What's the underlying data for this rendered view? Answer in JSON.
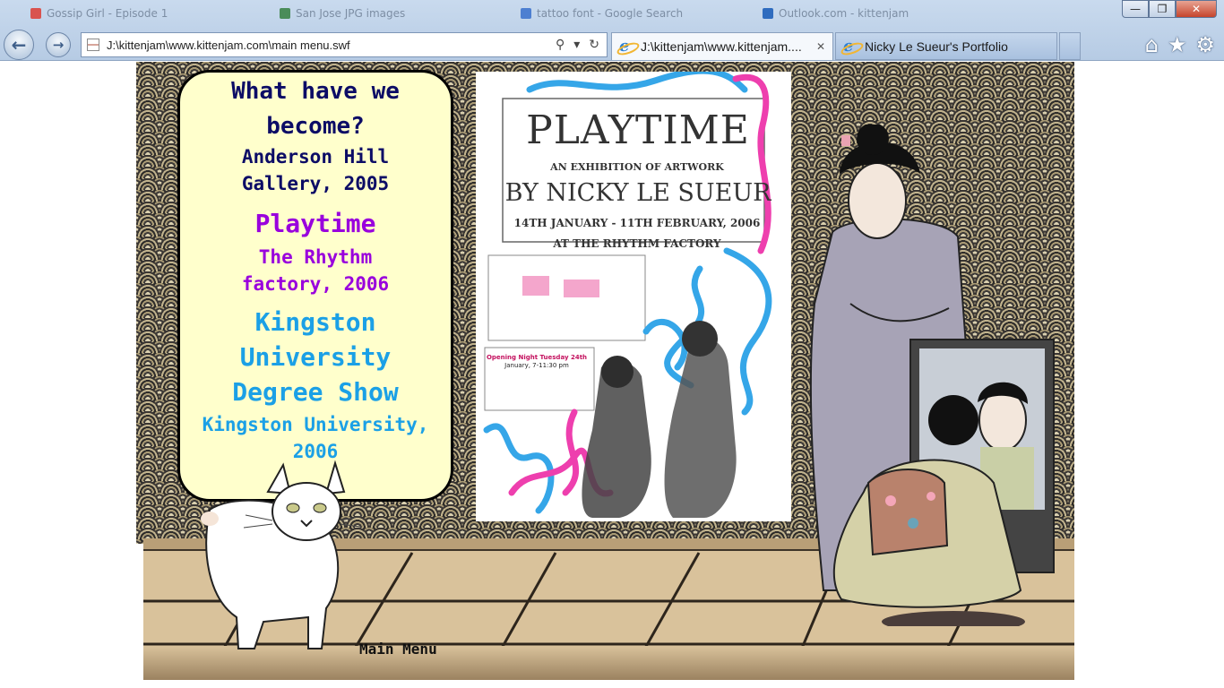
{
  "browser": {
    "background_tabs": [
      "Gossip Girl - Episode 1",
      "San Jose JPG images",
      "tattoo font - Google Search",
      "Outlook.com - kittenjam"
    ],
    "address_url": "J:\\kittenjam\\www.kittenjam.com\\main menu.swf",
    "tabs": [
      {
        "label": "J:\\kittenjam\\www.kittenjam....",
        "active": true
      },
      {
        "label": "Nicky Le Sueur's Portfolio",
        "active": false
      }
    ],
    "window_buttons": {
      "minimize": "—",
      "restore": "❐",
      "close": "✕"
    },
    "icons": {
      "back": "back-arrow-icon",
      "forward": "forward-arrow-icon",
      "home": "home-icon",
      "favorites": "star-icon",
      "tools": "gear-icon"
    }
  },
  "panel": {
    "heading": [
      "What have we",
      "become?"
    ],
    "heading_venue": [
      "Anderson Hill",
      "Gallery, 2005"
    ],
    "playtime_title": "Playtime",
    "playtime_venue": [
      "The Rhythm",
      "factory, 2006"
    ],
    "kingston_title": [
      "Kingston",
      "University",
      "Degree Show"
    ],
    "kingston_venue": [
      "Kingston University,",
      "2006"
    ]
  },
  "poster": {
    "title": "PLAYTIME",
    "subtitle": "AN EXHIBITION OF ARTWORK",
    "by_line": "BY NICKY LE SUEUR",
    "dates": "14TH JANUARY - 11TH FEBRUARY, 2006",
    "venue": "AT THE RHYTHM FACTORY",
    "opening_heading": "Opening Night Tuesday 24th",
    "opening_body": "January, 7-11:30 pm"
  },
  "main_menu_label": "Main Menu",
  "colors": {
    "navy": "#0c0c66",
    "purple": "#9900dd",
    "blue": "#1ba0e6",
    "panel_bg": "#ffffcc"
  }
}
